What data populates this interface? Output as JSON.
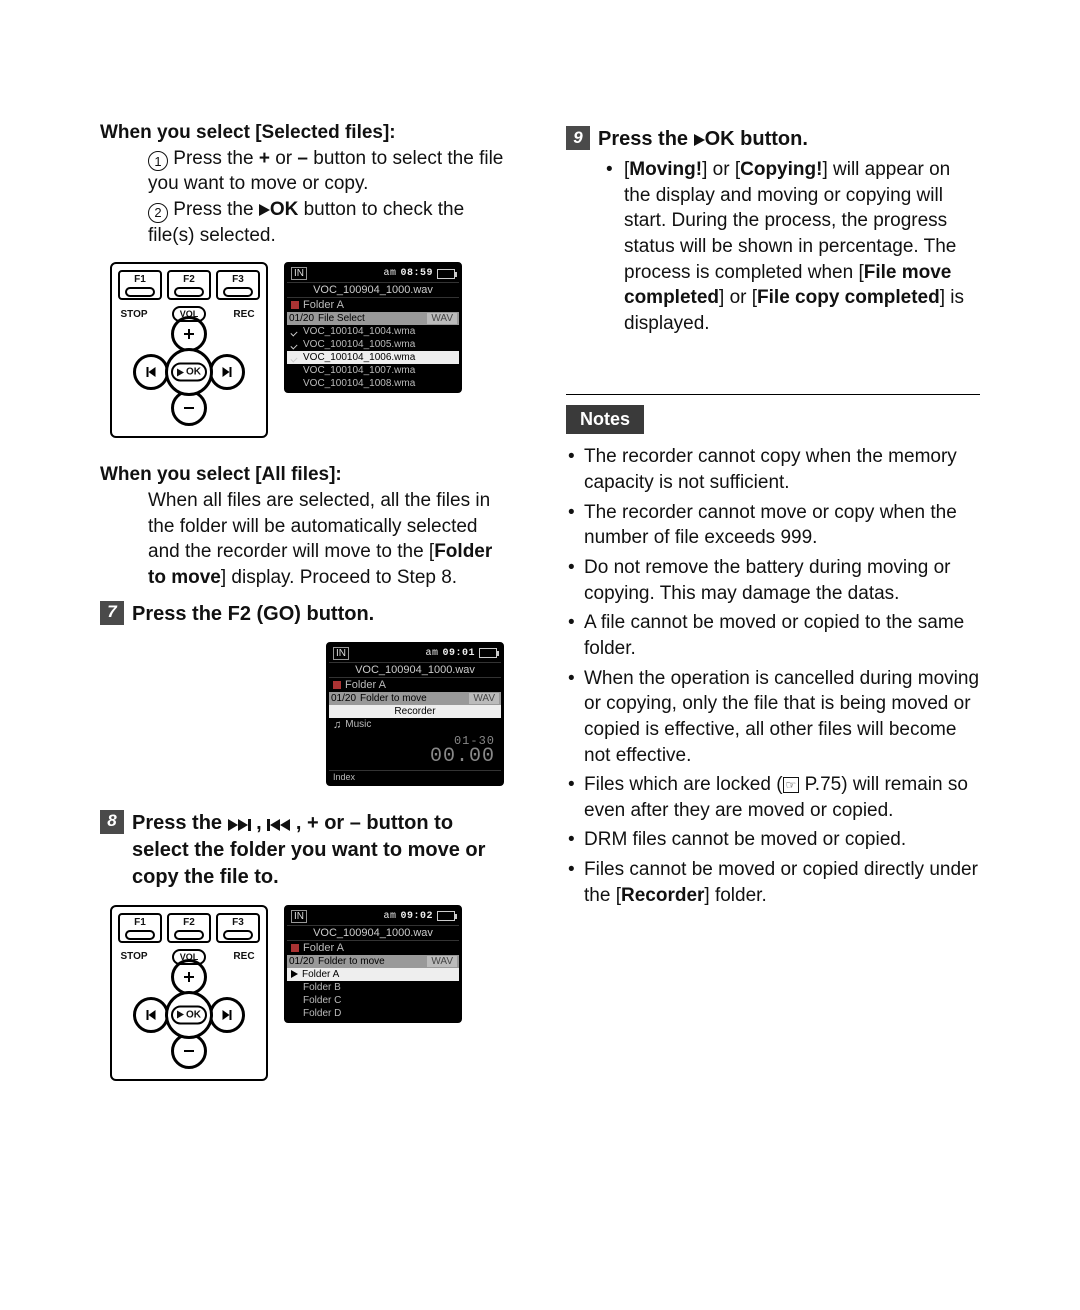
{
  "left": {
    "sel_title_a": "When you select [",
    "sel_title_b": "Selected files",
    "sel_title_c": "]:",
    "step1a": "Press the ",
    "step1b": "+",
    "step1c": " or ",
    "step1d": "–",
    "step1e": " button to select the file you want to move or copy.",
    "step2a": "Press the ",
    "step2ok": "OK",
    "step2b": " button to check the file(s) selected.",
    "all_title_a": "When you select [",
    "all_title_b": "All files",
    "all_title_c": "]:",
    "all_body_a": "When all files are selected, all the files in the folder will be automatically selected and the recorder will move to the [",
    "all_body_b": "Folder to move",
    "all_body_c": "] display. Proceed to Step 8.",
    "step7": "Press the F2 (GO) button.",
    "step8_a": "Press the ",
    "step8_b": " , ",
    "step8_c": " , + or ",
    "step8_d": "–",
    "step8_e": " button to select the folder you want to move or copy the file to."
  },
  "right": {
    "step9_a": "Press the ",
    "step9_ok": "OK",
    "step9_b": " button.",
    "desc_a": "[",
    "desc_b": "Moving!",
    "desc_c": "] or [",
    "desc_d": "Copying!",
    "desc_e": "] will appear on the display and moving or copying will start. During the process, the progress status will be shown in percentage. The process is completed when [",
    "desc_f": "File move completed",
    "desc_g": "] or [",
    "desc_h": "File copy completed",
    "desc_i": "] is displayed.",
    "notes_label": "Notes",
    "n1": "The recorder cannot copy when the memory capacity is not sufficient.",
    "n2": "The recorder cannot move or copy when the number of file exceeds 999.",
    "n3": "Do not remove the battery during moving or copying. This may damage the datas.",
    "n4": "A file cannot be moved or copied to the same folder.",
    "n5": "When the operation is cancelled during moving or copying, only the file that is being moved or copied is effective, all other files will become not effective.",
    "n6_a": "Files which are locked (",
    "n6_b": " P.75) will remain so even after they are moved or copied.",
    "n7": "DRM files cannot be moved or copied.",
    "n8_a": "Files cannot be moved or copied directly under the [",
    "n8_b": "Recorder",
    "n8_c": "] folder."
  },
  "pad": {
    "f1": "F1",
    "f2": "F2",
    "f3": "F3",
    "stop": "STOP",
    "rec": "REC",
    "vol": "VOL",
    "ok": "OK"
  },
  "lcd1": {
    "in": "IN",
    "am": "am",
    "time": "08:59",
    "title": "VOC_100904_1000.wav",
    "folder": "Folder A",
    "banner_left": "01/20",
    "banner_mid": "File Select",
    "banner_right": "WAV",
    "items": [
      {
        "name": "VOC_100104_1004.wma",
        "checked": true,
        "sel": false
      },
      {
        "name": "VOC_100104_1005.wma",
        "checked": true,
        "sel": false
      },
      {
        "name": "VOC_100104_1006.wma",
        "checked": true,
        "sel": true
      },
      {
        "name": "VOC_100104_1007.wma",
        "checked": false,
        "sel": false
      },
      {
        "name": "VOC_100104_1008.wma",
        "checked": false,
        "sel": false
      }
    ]
  },
  "lcd2": {
    "in": "IN",
    "am": "am",
    "time": "09:01",
    "title": "VOC_100904_1000.wav",
    "folder": "Folder A",
    "banner_left": "01/20",
    "banner_mid": "Folder to move",
    "banner_right": "WAV",
    "recorder": "Recorder",
    "music": "Music",
    "counter_a": "01-30",
    "counter_b": "00.00",
    "index": "Index"
  },
  "lcd3": {
    "in": "IN",
    "am": "am",
    "time": "09:02",
    "title": "VOC_100904_1000.wav",
    "folder": "Folder A",
    "banner_left": "01/20",
    "banner_mid": "Folder to move",
    "banner_right": "WAV",
    "items": [
      "Folder A",
      "Folder B",
      "Folder C",
      "Folder D"
    ]
  },
  "stepnums": {
    "s7": "7",
    "s8": "8",
    "s9": "9"
  },
  "subnums": {
    "c1": "1",
    "c2": "2"
  }
}
